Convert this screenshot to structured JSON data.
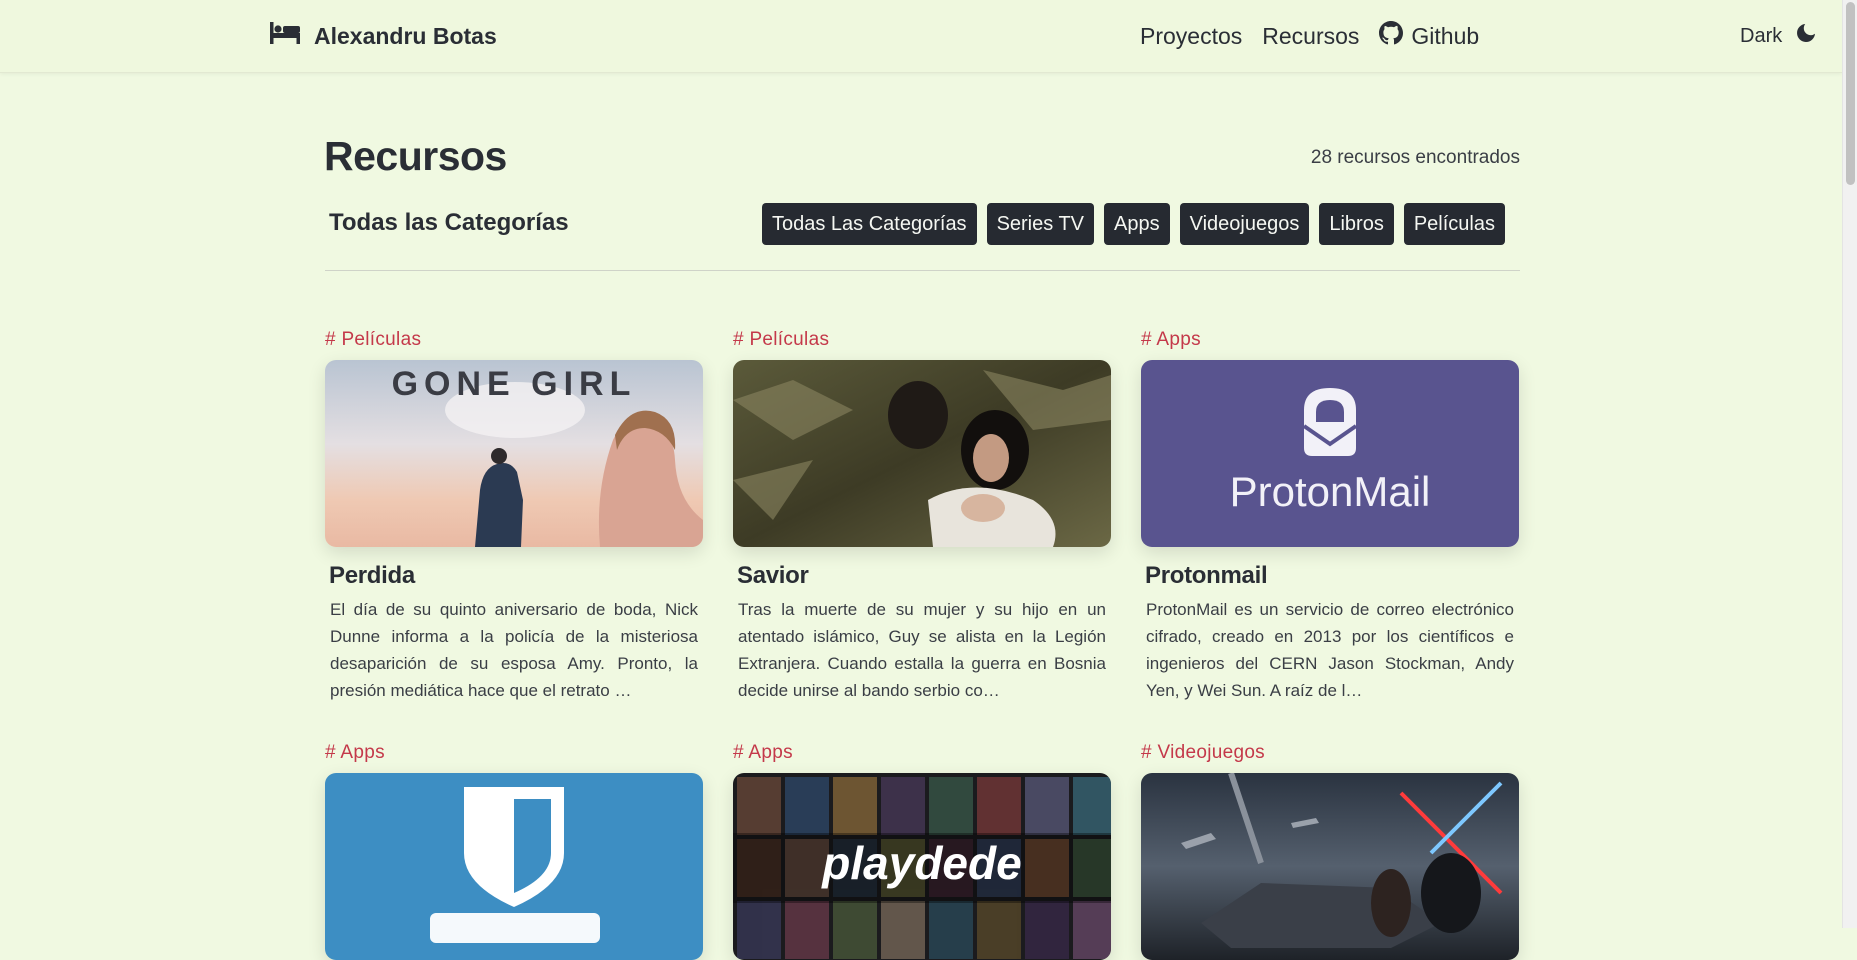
{
  "navbar": {
    "brand_name": "Alexandru Botas",
    "links": [
      "Proyectos",
      "Recursos",
      "Github"
    ],
    "theme_label": "Dark"
  },
  "header": {
    "title": "Recursos",
    "result_count": "28 recursos encontrados",
    "category_title": "Todas las Categorías"
  },
  "filters": [
    "Todas Las Categorías",
    "Series TV",
    "Apps",
    "Videojuegos",
    "Libros",
    "Películas"
  ],
  "cards": [
    {
      "tag": "# Películas",
      "title": "Perdida",
      "image_text": "GONE GIRL",
      "description": "El día de su quinto aniversario de boda, Nick Dunne informa a la policía de la misteriosa desaparición de su esposa Amy. Pronto, la presión mediática hace que el retrato …"
    },
    {
      "tag": "# Películas",
      "title": "Savior",
      "description": "Tras la muerte de su mujer y su hijo en un atentado islámico, Guy se alista en la Legión Extranjera. Cuando estalla la guerra en Bosnia decide unirse al bando serbio co…"
    },
    {
      "tag": "# Apps",
      "title": "Protonmail",
      "image_text": "ProtonMail",
      "description": "ProtonMail es un servicio de correo electrónico cifrado, creado en 2013 por los científicos e ingenieros del CERN Jason Stockman, Andy Yen, y Wei Sun. A raíz de l…"
    },
    {
      "tag": "# Apps"
    },
    {
      "tag": "# Apps",
      "image_text": "playdede"
    },
    {
      "tag": "# Videojuegos"
    }
  ],
  "colors": {
    "page_background": "#f0f9e1",
    "tag_color": "#c4394a",
    "filter_button_bg": "#262a31"
  },
  "icons": {
    "brand": "bed-icon",
    "github": "github-icon",
    "theme": "moon-icon"
  }
}
